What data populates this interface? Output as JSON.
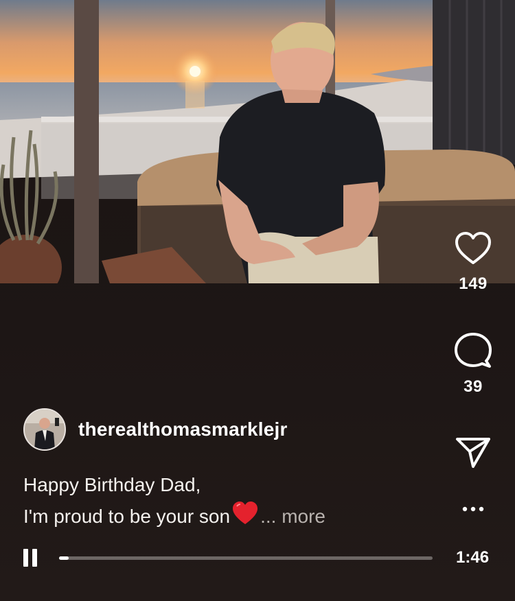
{
  "video": {
    "scene": "man seated on covered hot tub on balcony at sunset over ocean"
  },
  "actions": {
    "like_count": "149",
    "comment_count": "39"
  },
  "author": {
    "username": "therealthomasmarklejr"
  },
  "caption": {
    "line1": "Happy Birthday Dad,",
    "line2": "I'm proud to be your son",
    "ellipsis": "...",
    "more_label": "more"
  },
  "player": {
    "time": "1:46",
    "progress": 0.02,
    "state": "playing"
  },
  "icons": [
    "heart-icon",
    "comment-icon",
    "send-icon",
    "more-icon",
    "pause-icon",
    "red-heart-emoji"
  ]
}
